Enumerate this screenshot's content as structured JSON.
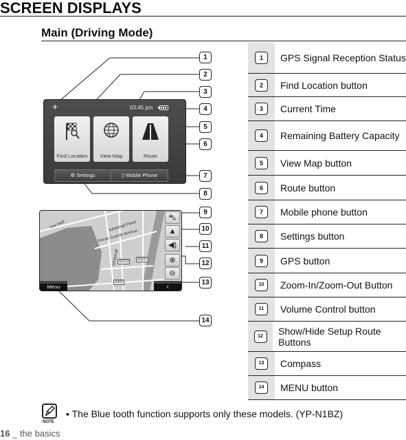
{
  "page": {
    "title": "SCREEN DISPLAYS",
    "section_title": "Main (Driving Mode)"
  },
  "home_screen": {
    "time": "03:45 pm",
    "gps_icon": "satellite-icon",
    "battery_icon": "battery-icon",
    "buttons": [
      {
        "label": "Find Location",
        "icon": "checkered-flag-magnifier-icon"
      },
      {
        "label": "View Map",
        "icon": "globe-icon"
      },
      {
        "label": "Route",
        "icon": "road-icon"
      }
    ],
    "bottom_bar": {
      "settings_label": "Settings",
      "settings_icon": "gear-icon",
      "mobile_label": "Mobile Phone",
      "mobile_icon": "mobile-phone-icon"
    }
  },
  "map_screen": {
    "menu_label": "Menu",
    "compass_glyph": "‹",
    "side_buttons": [
      {
        "name": "gps",
        "glyph": "🚗",
        "icon": "car-icon"
      },
      {
        "name": "compass-arrow",
        "glyph": "▲",
        "icon": "direction-arrow-icon"
      },
      {
        "name": "volume",
        "glyph": "🔈",
        "icon": "speaker-icon"
      },
      {
        "name": "zoom-in",
        "glyph": "⊕",
        "icon": "zoom-in-icon"
      },
      {
        "name": "zoom-out",
        "glyph": "⊖",
        "icon": "zoom-out-icon"
      }
    ],
    "road_labels": [
      "Whitehall Place",
      "Horse Guards Avenue",
      "The Mall",
      "Whitehall"
    ],
    "road_shields": [
      "A3212",
      "A3211",
      "A302"
    ]
  },
  "callouts": [
    "1",
    "2",
    "3",
    "4",
    "5",
    "6",
    "7",
    "8",
    "9",
    "10",
    "11",
    "12",
    "13",
    "14"
  ],
  "legend": [
    {
      "num": "1",
      "text": "GPS Signal Reception Status"
    },
    {
      "num": "2",
      "text": "Find Location button"
    },
    {
      "num": "3",
      "text": "Current Time"
    },
    {
      "num": "4",
      "text": "Remaining Battery Capacity"
    },
    {
      "num": "5",
      "text": "View Map button"
    },
    {
      "num": "6",
      "text": "Route button"
    },
    {
      "num": "7",
      "text": "Mobile phone button"
    },
    {
      "num": "8",
      "text": "Settings button"
    },
    {
      "num": "9",
      "text": "GPS button"
    },
    {
      "num": "10",
      "text": "Zoom-In/Zoom-Out Button"
    },
    {
      "num": "11",
      "text": "Volume Control button"
    },
    {
      "num": "12",
      "text": "Show/Hide Setup Route Buttons"
    },
    {
      "num": "13",
      "text": "Compass"
    },
    {
      "num": "14",
      "text": "MENU button"
    }
  ],
  "note": {
    "label": "NOTE",
    "text": "▪ The Blue tooth function supports only these models. (YP-N1BZ)"
  },
  "footer": {
    "page_number": "16",
    "text": " _ the basics"
  }
}
